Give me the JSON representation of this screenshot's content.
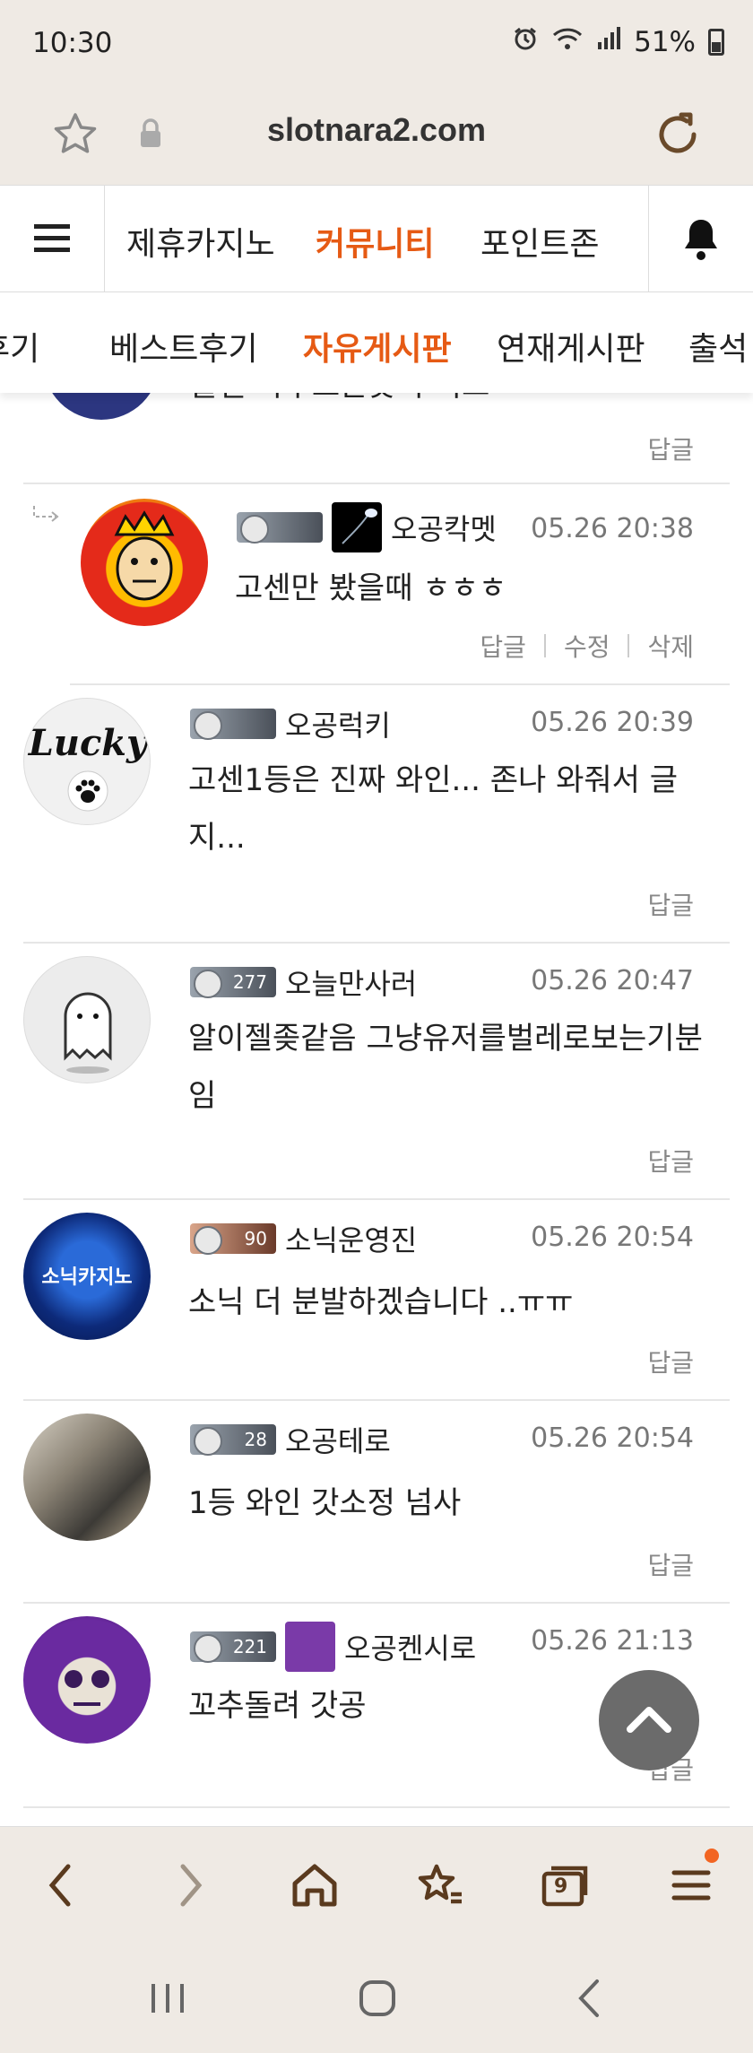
{
  "status": {
    "time": "10:30",
    "battery": "51%"
  },
  "browser": {
    "url": "slotnara2.com",
    "tab_count": "9"
  },
  "site_nav": {
    "items": [
      "제휴카지노",
      "커뮤니티",
      "포인트존"
    ],
    "active_index": 1
  },
  "sub_tabs": [
    "후기",
    "베스트후기",
    "자유게시판",
    "연재게시판",
    "출석"
  ],
  "sub_active_index": 2,
  "partial_comment": {
    "text": "출필 자주오는곳이 최고",
    "reply": "답글"
  },
  "comments": [
    {
      "nick": "오공칵멧",
      "time": "05.26 20:38",
      "body": "고센만 봤을때 ㅎㅎㅎ",
      "actions": [
        "답글",
        "수정",
        "삭제"
      ],
      "level": "",
      "is_reply": true
    },
    {
      "nick": "오공럭키",
      "time": "05.26 20:39",
      "body": "고센1등은 진짜 와인... 존나 와줘서 글지...",
      "actions": [
        "답글"
      ],
      "level": ""
    },
    {
      "nick": "오늘만사러",
      "time": "05.26 20:47",
      "body": "알이젤좆같음 그냥유저를벌레로보는기분임",
      "actions": [
        "답글"
      ],
      "level": "277"
    },
    {
      "nick": "소닉운영진",
      "time": "05.26 20:54",
      "body": "소닉 더 분발하겠습니다 ..ㅠㅠ",
      "actions": [
        "답글"
      ],
      "level": "90"
    },
    {
      "nick": "오공테로",
      "time": "05.26 20:54",
      "body": "1등 와인 갓소정 넘사",
      "actions": [
        "답글"
      ],
      "level": "28"
    },
    {
      "nick": "오공켄시로",
      "time": "05.26 21:13",
      "body": "꼬추돌려 갓공",
      "actions": [
        "답글"
      ],
      "level": "221"
    }
  ],
  "avatar_texts": {
    "lucky": "Lucky",
    "sonic": "소닉카지노"
  },
  "icons": {
    "bookmark": "star-icon",
    "lock": "lock-icon",
    "refresh": "refresh-icon",
    "menu": "hamburger-icon",
    "bell": "bell-icon",
    "to_top": "chevron-up-icon"
  },
  "colors": {
    "accent": "#e65a14",
    "bar_bg": "#efeae4"
  }
}
